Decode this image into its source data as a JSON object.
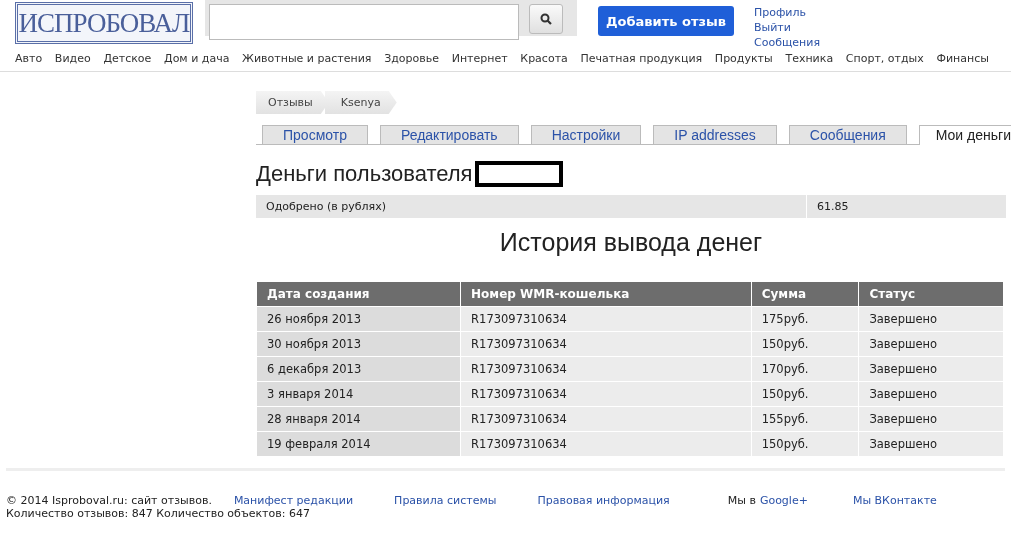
{
  "header": {
    "logo": "ИСПРОБОВАЛ",
    "add_button": "Добавить отзыв",
    "user_links": [
      "Профиль",
      "Выйти",
      "Сообщения"
    ]
  },
  "categories": [
    "Авто",
    "Видео",
    "Детское",
    "Дом и дача",
    "Животные и растения",
    "Здоровье",
    "Интернет",
    "Красота",
    "Печатная продукция",
    "Продукты",
    "Техника",
    "Спорт, отдых",
    "Финансы"
  ],
  "breadcrumb": [
    "Отзывы",
    "Ksenya"
  ],
  "tabs": [
    {
      "label": "Просмотр",
      "selected": false
    },
    {
      "label": "Редактировать",
      "selected": false
    },
    {
      "label": "Настройки",
      "selected": false
    },
    {
      "label": "IP addresses",
      "selected": false
    },
    {
      "label": "Сообщения",
      "selected": false
    },
    {
      "label": "Мои деньги",
      "selected": true
    }
  ],
  "heading": "Деньги пользователя",
  "balance": {
    "label": "Одобрено (в рублях)",
    "value": "61.85"
  },
  "history_title": "История вывода денег",
  "table": {
    "columns": [
      "Дата создания",
      "Номер WMR-кошелька",
      "Сумма",
      "Статус"
    ],
    "rows": [
      [
        "26 ноября 2013",
        "R173097310634",
        "175руб.",
        "Завершено"
      ],
      [
        "30 ноября 2013",
        "R173097310634",
        "150руб.",
        "Завершено"
      ],
      [
        "6 декабря 2013",
        "R173097310634",
        "170руб.",
        "Завершено"
      ],
      [
        "3 января 2014",
        "R173097310634",
        "150руб.",
        "Завершено"
      ],
      [
        "28 января 2014",
        "R173097310634",
        "155руб.",
        "Завершено"
      ],
      [
        "19 февраля 2014",
        "R173097310634",
        "150руб.",
        "Завершено"
      ]
    ]
  },
  "footer": {
    "copyright": "© 2014 Isproboval.ru: сайт отзывов.",
    "links": [
      "Манифест редакции",
      "Правила системы",
      "Правовая информация"
    ],
    "google_prefix": "Мы в",
    "google_link": "Google+",
    "vk_link": "Мы ВКонтакте",
    "stats": "Количество отзывов: 847 Количество объектов: 647"
  }
}
